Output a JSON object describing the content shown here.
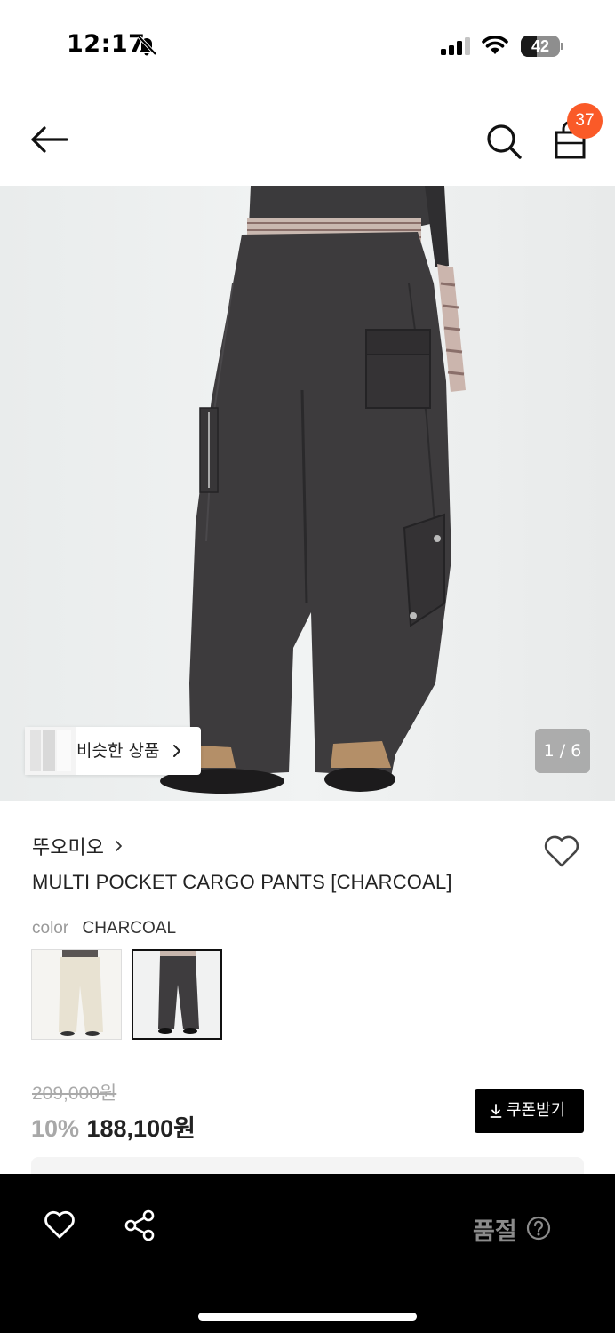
{
  "status_bar": {
    "time": "12:17",
    "battery": "42",
    "battery_level": 0.42
  },
  "header": {
    "cart_count": "37"
  },
  "gallery": {
    "similar_label": "비슷한 상품",
    "image_counter": "1 / 6"
  },
  "product": {
    "brand": "뚜오미오",
    "title": "MULTI POCKET CARGO PANTS [CHARCOAL]",
    "color_label": "color",
    "color_value": "CHARCOAL",
    "original_price": "209,000원",
    "discount_rate": "10%",
    "sale_price": "188,100원",
    "coupon_label": "쿠폰받기"
  },
  "bottom_bar": {
    "soldout_label": "품절"
  },
  "colors": {
    "badge": "#fa5a28",
    "bottom_bar": "#000000",
    "soldout_text": "#8b8b8b"
  }
}
